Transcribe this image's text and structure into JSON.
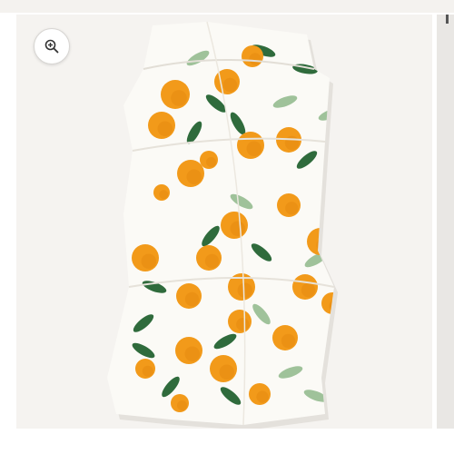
{
  "gallery": {
    "zoom_button": {
      "icon": "zoom-in-icon"
    },
    "product_image": {
      "subject": "clementine-print-muslin-swaddle"
    }
  },
  "colors": {
    "background": "#f5f3f0",
    "fabric": "#fbfaf6",
    "orange": "#f29a1a",
    "orange_dark": "#e0820c",
    "leaf": "#2f6b3c",
    "leaf_light": "#9fc29a"
  }
}
